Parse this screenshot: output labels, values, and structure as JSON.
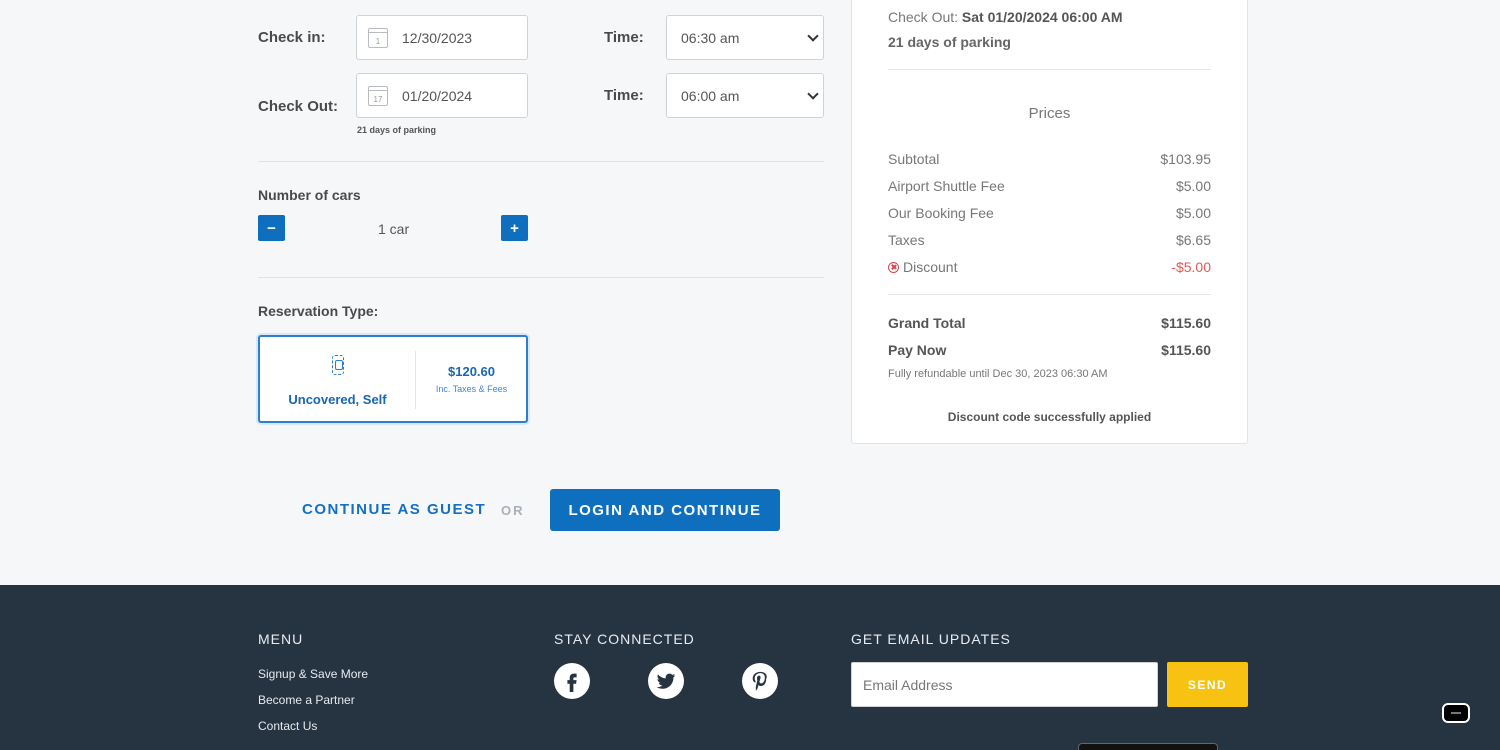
{
  "form": {
    "checkin_label": "Check in:",
    "checkin_date": "12/30/2023",
    "checkin_cal_day": "1",
    "checkin_time_label": "Time:",
    "checkin_time": "06:30 am",
    "checkout_label": "Check Out:",
    "checkout_date": "01/20/2024",
    "checkout_cal_day": "17",
    "checkout_time_label": "Time:",
    "checkout_time": "06:00 am",
    "days_note": "21 days of parking",
    "cars_label": "Number of cars",
    "minus": "−",
    "plus": "+",
    "car_count": "1 car",
    "reservation_label": "Reservation Type:",
    "reservation": {
      "type": "Uncovered, Self",
      "price": "$120.60",
      "inc": "Inc. Taxes & Fees"
    }
  },
  "actions": {
    "guest": "CONTINUE AS GUEST",
    "or": "OR",
    "login": "LOGIN AND CONTINUE"
  },
  "summary": {
    "checkout_prefix": "Check Out:",
    "checkout_value": "Sat 01/20/2024 06:00 AM",
    "days": "21 days of parking",
    "prices_title": "Prices",
    "lines": [
      {
        "label": "Subtotal",
        "amount": "$103.95"
      },
      {
        "label": "Airport Shuttle Fee",
        "amount": "$5.00"
      },
      {
        "label": "Our Booking Fee",
        "amount": "$5.00"
      },
      {
        "label": "Taxes",
        "amount": "$6.65"
      },
      {
        "label": "Discount",
        "amount": "-$5.00"
      }
    ],
    "grand_total_label": "Grand Total",
    "grand_total": "$115.60",
    "pay_now_label": "Pay Now",
    "pay_now": "$115.60",
    "refund_note": "Fully refundable until Dec 30, 2023 06:30 AM",
    "discount_applied": "Discount code successfully applied"
  },
  "footer": {
    "menu_title": "MENU",
    "menu_links": [
      "Signup & Save More",
      "Become a Partner",
      "Contact Us"
    ],
    "social_title": "STAY CONNECTED",
    "email_title": "GET EMAIL UPDATES",
    "email_placeholder": "Email Address",
    "send": "SEND"
  },
  "colors": {
    "primary": "#0f6fbf",
    "footer_bg": "#263442",
    "send": "#f8c212",
    "discount": "#e05858"
  },
  "icons": [
    "calendar-icon",
    "car-icon",
    "discount-remove-icon",
    "facebook-icon",
    "twitter-icon",
    "pinterest-icon",
    "chat-icon"
  ]
}
